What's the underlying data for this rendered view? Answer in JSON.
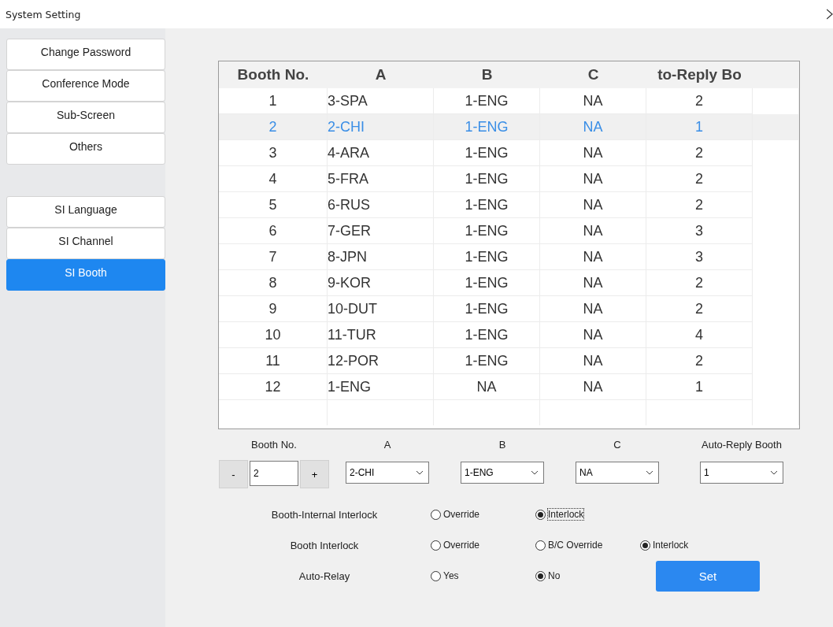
{
  "window": {
    "title": "System Setting"
  },
  "sidebar": {
    "groups": [
      [
        {
          "label": "Change Password",
          "selected": false
        },
        {
          "label": "Conference Mode",
          "selected": false
        },
        {
          "label": "Sub-Screen",
          "selected": false
        },
        {
          "label": "Others",
          "selected": false
        }
      ],
      [
        {
          "label": "SI Language",
          "selected": false
        },
        {
          "label": "SI Channel",
          "selected": false
        },
        {
          "label": "SI Booth",
          "selected": true
        }
      ]
    ]
  },
  "table": {
    "columns": [
      "Booth No.",
      "A",
      "B",
      "C",
      "to-Reply Bo"
    ],
    "rows": [
      {
        "cells": [
          "1",
          "3-SPA",
          "1-ENG",
          "NA",
          "2"
        ],
        "selected": false
      },
      {
        "cells": [
          "2",
          "2-CHI",
          "1-ENG",
          "NA",
          "1"
        ],
        "selected": true
      },
      {
        "cells": [
          "3",
          "4-ARA",
          "1-ENG",
          "NA",
          "2"
        ],
        "selected": false
      },
      {
        "cells": [
          "4",
          "5-FRA",
          "1-ENG",
          "NA",
          "2"
        ],
        "selected": false
      },
      {
        "cells": [
          "5",
          "6-RUS",
          "1-ENG",
          "NA",
          "2"
        ],
        "selected": false
      },
      {
        "cells": [
          "6",
          "7-GER",
          "1-ENG",
          "NA",
          "3"
        ],
        "selected": false
      },
      {
        "cells": [
          "7",
          "8-JPN",
          "1-ENG",
          "NA",
          "3"
        ],
        "selected": false
      },
      {
        "cells": [
          "8",
          "9-KOR",
          "1-ENG",
          "NA",
          "2"
        ],
        "selected": false
      },
      {
        "cells": [
          "9",
          "10-DUT",
          "1-ENG",
          "NA",
          "2"
        ],
        "selected": false
      },
      {
        "cells": [
          "10",
          "11-TUR",
          "1-ENG",
          "NA",
          "4"
        ],
        "selected": false
      },
      {
        "cells": [
          "11",
          "12-POR",
          "1-ENG",
          "NA",
          "2"
        ],
        "selected": false
      },
      {
        "cells": [
          "12",
          "1-ENG",
          "NA",
          "NA",
          "1"
        ],
        "selected": false
      }
    ]
  },
  "editor": {
    "booth_no": {
      "label": "Booth No.",
      "value": "2",
      "minus": "-",
      "plus": "+"
    },
    "selects": [
      {
        "label": "A",
        "value": "2-CHI"
      },
      {
        "label": "B",
        "value": "1-ENG"
      },
      {
        "label": "C",
        "value": "NA"
      },
      {
        "label": "Auto-Reply Booth",
        "value": "1"
      }
    ]
  },
  "options": [
    {
      "label": "Booth-Internal Interlock",
      "choices": [
        {
          "label": "Override",
          "selected": false,
          "focused": false
        },
        {
          "label": "Interlock",
          "selected": true,
          "focused": true
        }
      ]
    },
    {
      "label": "Booth Interlock",
      "choices": [
        {
          "label": "Override",
          "selected": false,
          "focused": false
        },
        {
          "label": "B/C Override",
          "selected": false,
          "focused": false
        },
        {
          "label": "Interlock",
          "selected": true,
          "focused": false
        }
      ]
    },
    {
      "label": "Auto-Relay",
      "choices": [
        {
          "label": "Yes",
          "selected": false,
          "focused": false
        },
        {
          "label": "No",
          "selected": true,
          "focused": false
        }
      ]
    }
  ],
  "set_button": "Set"
}
